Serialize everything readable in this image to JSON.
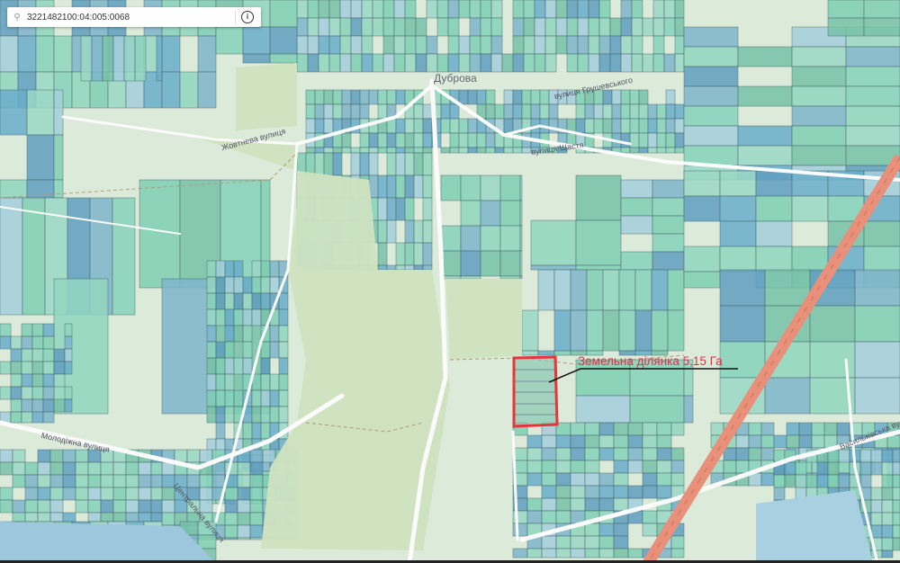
{
  "search": {
    "value": "3221482100:04:005:0068",
    "placeholder": "",
    "icon": "search-icon",
    "info_icon": "info-icon"
  },
  "map": {
    "place_labels": [
      "Дуброва"
    ],
    "street_labels": [
      "Молодіжна вулиця",
      "Центральна вулиця",
      "Васильківська вулиця",
      "вулиця Щастя",
      "Жовтнева вулиця",
      "вулиця Грушевського"
    ],
    "plot_annotation": "Земельна ділянка 5,15 Га",
    "colors": {
      "annotation": "#e0304a",
      "highway": "#e8907a",
      "forest": "#cfe3c4",
      "parcel_teal": "#7fcfb4",
      "parcel_blue": "#7fb6cc"
    }
  }
}
